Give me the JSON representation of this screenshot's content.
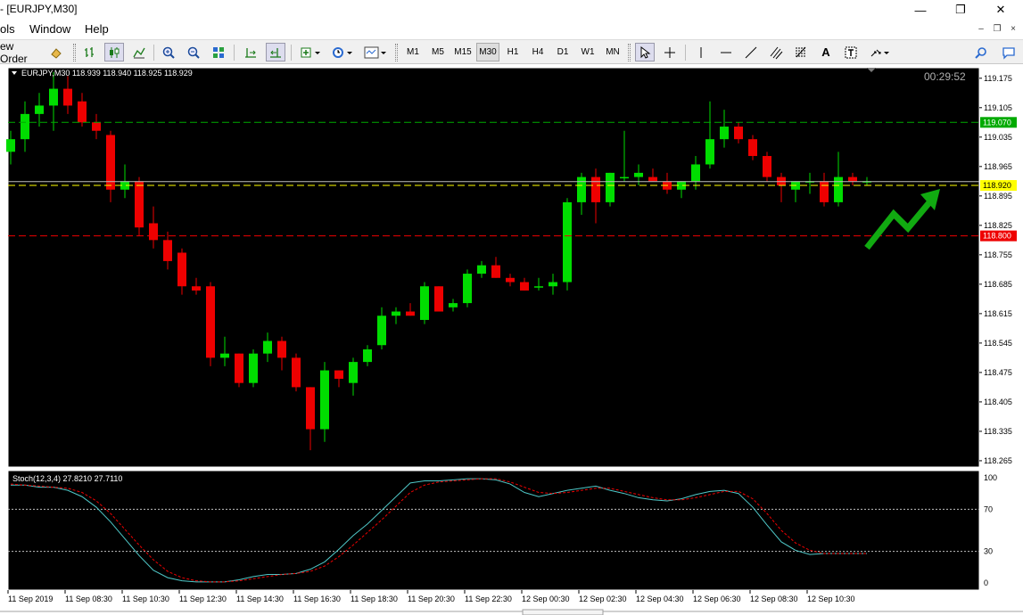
{
  "window": {
    "title": "- [EURJPY,M30]",
    "controls": {
      "minimize": "—",
      "restore": "❐",
      "close": "✕"
    }
  },
  "menu": {
    "items": [
      "ols",
      "Window",
      "Help"
    ],
    "mdi": {
      "minimize": "–",
      "restore": "❐",
      "close": "×"
    }
  },
  "toolbar": {
    "new_order_label": "ew Order",
    "periods": [
      "M1",
      "M5",
      "M15",
      "M30",
      "H1",
      "H4",
      "D1",
      "W1",
      "MN"
    ],
    "active_period": "M30",
    "text_tool": "A"
  },
  "chart": {
    "symbol_info": "EURJPY,M30  118.939 118.940 118.925 118.929",
    "timer": "00:29:52",
    "colors": {
      "background": "#000000",
      "bull": "#00dd00",
      "bear": "#ee0000",
      "grid": "#ffffff",
      "axis_text": "#000000",
      "stoch_main": "#4fc8c8",
      "stoch_signal": "#ee0000",
      "line_top": "#00aa00",
      "line_mid": "#ffff00",
      "line_low": "#ee0000",
      "arrow": "#11aa11"
    },
    "price_labels": [
      "119.175",
      "119.105",
      "119.035",
      "118.965",
      "118.895",
      "118.825",
      "118.755",
      "118.685",
      "118.615",
      "118.545",
      "118.475",
      "118.405",
      "118.335",
      "118.265"
    ],
    "horizontal_lines": [
      {
        "price": 119.07,
        "label": "119.070",
        "style": "dashed",
        "color": "#00aa00",
        "tag_bg": "#00aa00",
        "tag_fg": "#ffffff"
      },
      {
        "price": 118.92,
        "label": "118.920",
        "style": "dashed",
        "color": "#ffff00",
        "tag_bg": "#ffff00",
        "tag_fg": "#000000"
      },
      {
        "price": 118.8,
        "label": "118.800",
        "style": "dashed",
        "color": "#ee0000",
        "tag_bg": "#ee0000",
        "tag_fg": "#ffffff"
      }
    ],
    "bid_line_price": 118.929,
    "time_labels": [
      "11 Sep 2019",
      "11 Sep 08:30",
      "11 Sep 10:30",
      "11 Sep 12:30",
      "11 Sep 14:30",
      "11 Sep 16:30",
      "11 Sep 18:30",
      "11 Sep 20:30",
      "11 Sep 22:30",
      "12 Sep 00:30",
      "12 Sep 02:30",
      "12 Sep 04:30",
      "12 Sep 06:30",
      "12 Sep 08:30",
      "12 Sep 10:30"
    ],
    "stoch": {
      "label": "Stoch(12,3,4) 27.8210 27.7110",
      "scale_labels": [
        "100",
        "70",
        "30",
        "0"
      ],
      "levels": [
        70,
        30
      ]
    }
  },
  "chart_data": {
    "type": "candlestick",
    "symbol": "EURJPY",
    "timeframe": "M30",
    "ylim": [
      118.25,
      119.2
    ],
    "candles": [
      [
        119.0,
        119.05,
        118.97,
        119.03
      ],
      [
        119.03,
        119.12,
        119.0,
        119.09
      ],
      [
        119.09,
        119.14,
        119.06,
        119.11
      ],
      [
        119.11,
        119.19,
        119.05,
        119.15
      ],
      [
        119.15,
        119.18,
        119.09,
        119.11
      ],
      [
        119.12,
        119.14,
        119.06,
        119.07
      ],
      [
        119.07,
        119.09,
        119.03,
        119.05
      ],
      [
        119.04,
        119.05,
        118.88,
        118.91
      ],
      [
        118.91,
        118.97,
        118.89,
        118.93
      ],
      [
        118.93,
        118.94,
        118.8,
        118.82
      ],
      [
        118.83,
        118.87,
        118.77,
        118.79
      ],
      [
        118.79,
        118.81,
        118.72,
        118.74
      ],
      [
        118.76,
        118.77,
        118.66,
        118.68
      ],
      [
        118.68,
        118.7,
        118.66,
        118.67
      ],
      [
        118.68,
        118.69,
        118.49,
        118.51
      ],
      [
        118.51,
        118.56,
        118.49,
        118.52
      ],
      [
        118.52,
        118.52,
        118.44,
        118.45
      ],
      [
        118.45,
        118.53,
        118.44,
        118.52
      ],
      [
        118.52,
        118.57,
        118.5,
        118.55
      ],
      [
        118.55,
        118.56,
        118.48,
        118.51
      ],
      [
        118.51,
        118.52,
        118.43,
        118.44
      ],
      [
        118.44,
        118.44,
        118.29,
        118.34
      ],
      [
        118.34,
        118.5,
        118.31,
        118.48
      ],
      [
        118.48,
        118.48,
        118.44,
        118.46
      ],
      [
        118.45,
        118.51,
        118.42,
        118.5
      ],
      [
        118.5,
        118.54,
        118.49,
        118.53
      ],
      [
        118.54,
        118.63,
        118.53,
        118.61
      ],
      [
        118.61,
        118.63,
        118.59,
        118.62
      ],
      [
        118.62,
        118.64,
        118.61,
        118.61
      ],
      [
        118.6,
        118.69,
        118.59,
        118.68
      ],
      [
        118.68,
        118.68,
        118.62,
        118.62
      ],
      [
        118.63,
        118.65,
        118.62,
        118.64
      ],
      [
        118.64,
        118.72,
        118.63,
        118.71
      ],
      [
        118.71,
        118.74,
        118.7,
        118.73
      ],
      [
        118.73,
        118.75,
        118.7,
        118.7
      ],
      [
        118.7,
        118.71,
        118.68,
        118.69
      ],
      [
        118.69,
        118.7,
        118.67,
        118.67
      ],
      [
        118.68,
        118.7,
        118.67,
        118.68
      ],
      [
        118.68,
        118.71,
        118.66,
        118.69
      ],
      [
        118.69,
        118.89,
        118.67,
        118.88
      ],
      [
        118.88,
        118.95,
        118.85,
        118.94
      ],
      [
        118.94,
        118.96,
        118.83,
        118.88
      ],
      [
        118.88,
        118.95,
        118.87,
        118.95
      ],
      [
        118.94,
        119.05,
        118.93,
        118.94
      ],
      [
        118.94,
        118.97,
        118.92,
        118.95
      ],
      [
        118.94,
        118.96,
        118.93,
        118.93
      ],
      [
        118.93,
        118.95,
        118.9,
        118.91
      ],
      [
        118.91,
        118.93,
        118.89,
        118.93
      ],
      [
        118.93,
        118.99,
        118.91,
        118.97
      ],
      [
        118.97,
        119.12,
        118.96,
        119.03
      ],
      [
        119.03,
        119.1,
        119.01,
        119.06
      ],
      [
        119.06,
        119.07,
        119.02,
        119.03
      ],
      [
        119.03,
        119.04,
        118.98,
        118.99
      ],
      [
        118.99,
        119.0,
        118.93,
        118.94
      ],
      [
        118.94,
        118.95,
        118.88,
        118.92
      ],
      [
        118.91,
        118.93,
        118.88,
        118.93
      ],
      [
        118.93,
        118.95,
        118.9,
        118.93
      ],
      [
        118.93,
        118.95,
        118.87,
        118.88
      ],
      [
        118.88,
        119.0,
        118.87,
        118.94
      ],
      [
        118.94,
        118.95,
        118.92,
        118.93
      ],
      [
        118.93,
        118.94,
        118.92,
        118.93
      ]
    ],
    "stoch_main": [
      93,
      93,
      91,
      91,
      88,
      82,
      72,
      58,
      42,
      26,
      12,
      5,
      2,
      1,
      1,
      1,
      3,
      6,
      8,
      8,
      9,
      13,
      20,
      32,
      45,
      56,
      69,
      82,
      95,
      97,
      97,
      98,
      99,
      99,
      98,
      94,
      86,
      82,
      85,
      88,
      90,
      92,
      88,
      85,
      81,
      79,
      78,
      80,
      84,
      87,
      88,
      85,
      72,
      55,
      39,
      31,
      27,
      28,
      28,
      28,
      28
    ],
    "stoch_signal": [
      94,
      93,
      92,
      91,
      90,
      86,
      78,
      66,
      51,
      36,
      22,
      11,
      5,
      2,
      1,
      1,
      2,
      4,
      6,
      8,
      9,
      11,
      16,
      25,
      36,
      48,
      60,
      73,
      86,
      93,
      96,
      97,
      98,
      99,
      99,
      96,
      91,
      86,
      85,
      86,
      88,
      90,
      90,
      87,
      84,
      81,
      79,
      79,
      81,
      84,
      87,
      87,
      80,
      66,
      50,
      38,
      31,
      28,
      28,
      28,
      28
    ]
  }
}
